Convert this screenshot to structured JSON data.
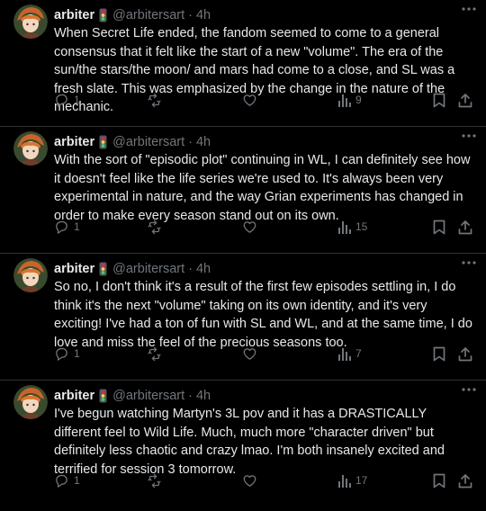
{
  "colors": {
    "background": "#000000",
    "text": "#e7e9ea",
    "muted": "#71767b",
    "divider": "#2f3336"
  },
  "tweets": [
    {
      "name": "arbiter",
      "handle": "@arbitersart",
      "separator": "·",
      "time": "4h",
      "text": "When Secret Life ended, the fandom seemed to come to a general consensus that it felt like the start of a new \"volume\". The era of the sun/the stars/the moon/ and mars had come to a close, and SL was a fresh slate. This was emphasized by the change in the nature of the mechanic.",
      "replies": "1",
      "views": "9"
    },
    {
      "name": "arbiter",
      "handle": "@arbitersart",
      "separator": "·",
      "time": "4h",
      "text": "With the sort of \"episodic plot\" continuing in WL, I can definitely see how it doesn't feel like the life series we're used to. It's always been very experimental in nature, and the way Grian experiments has changed in order to make every season stand out on its own.",
      "replies": "1",
      "views": "15"
    },
    {
      "name": "arbiter",
      "handle": "@arbitersart",
      "separator": "·",
      "time": "4h",
      "text": "So no, I don't think it's a result of the first few episodes settling in, I do think it's the next \"volume\" taking on its own identity, and it's very exciting! I've had a ton of fun with SL and WL, and at the same time, I do love and miss the feel of the precious seasons too.",
      "replies": "1",
      "views": "7"
    },
    {
      "name": "arbiter",
      "handle": "@arbitersart",
      "separator": "·",
      "time": "4h",
      "text": "I've begun watching Martyn's 3L pov and it has a DRASTICALLY different feel to Wild Life. Much, much more \"character driven\" but definitely less chaotic and crazy lmao. I'm both insanely excited and terrified for session 3 tomorrow.",
      "replies": "1",
      "views": "17"
    }
  ],
  "icons": {
    "reply": "reply-icon",
    "repost": "repost-icon",
    "like": "like-icon",
    "views": "views-icon",
    "bookmark": "bookmark-icon",
    "share": "share-icon",
    "more": "more-icon",
    "status_emoji": "traffic-light-icon"
  }
}
